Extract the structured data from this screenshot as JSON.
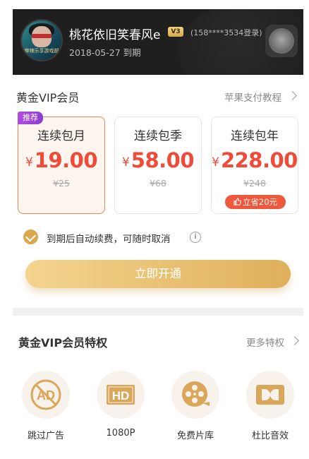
{
  "header": {
    "avatar_caption": "麻辣乐享游戏部",
    "username": "桃花依旧笑春风e",
    "vip_level": "V3",
    "phone": "(158****3534登录)",
    "expiry": "2018-05-27 到期"
  },
  "membership": {
    "title": "黄金VIP会员",
    "apple_pay_link": "苹果支付教程"
  },
  "plans": [
    {
      "name": "连续包月",
      "currency": "¥",
      "price": "19.00",
      "original": "¥25",
      "tag": "推荐",
      "selected": true
    },
    {
      "name": "连续包季",
      "currency": "¥",
      "price": "58.00",
      "original": "¥68",
      "selected": false
    },
    {
      "name": "连续包年",
      "currency": "¥",
      "price": "228.00",
      "original": "¥248",
      "save": "立省20元",
      "selected": false
    }
  ],
  "auto_renew": {
    "text": "到期后自动续费，可随时取消",
    "checked": true,
    "info_icon": "i"
  },
  "cta": {
    "label": "立即开通"
  },
  "privileges": {
    "title": "黄金VIP会员特权",
    "more_link": "更多特权",
    "items": [
      {
        "label": "跳过广告",
        "icon": "ad-skip-icon",
        "glyph": "AD"
      },
      {
        "label": "1080P",
        "icon": "hd-icon",
        "glyph": "HD"
      },
      {
        "label": "免费片库",
        "icon": "film-reel-icon"
      },
      {
        "label": "杜比音效",
        "icon": "dolby-icon"
      }
    ]
  },
  "colors": {
    "header_bg": "#1f1f1f",
    "price_red": "#f04a38",
    "gold": "#d9a84e",
    "recommend_purple": "#9a42d9"
  }
}
